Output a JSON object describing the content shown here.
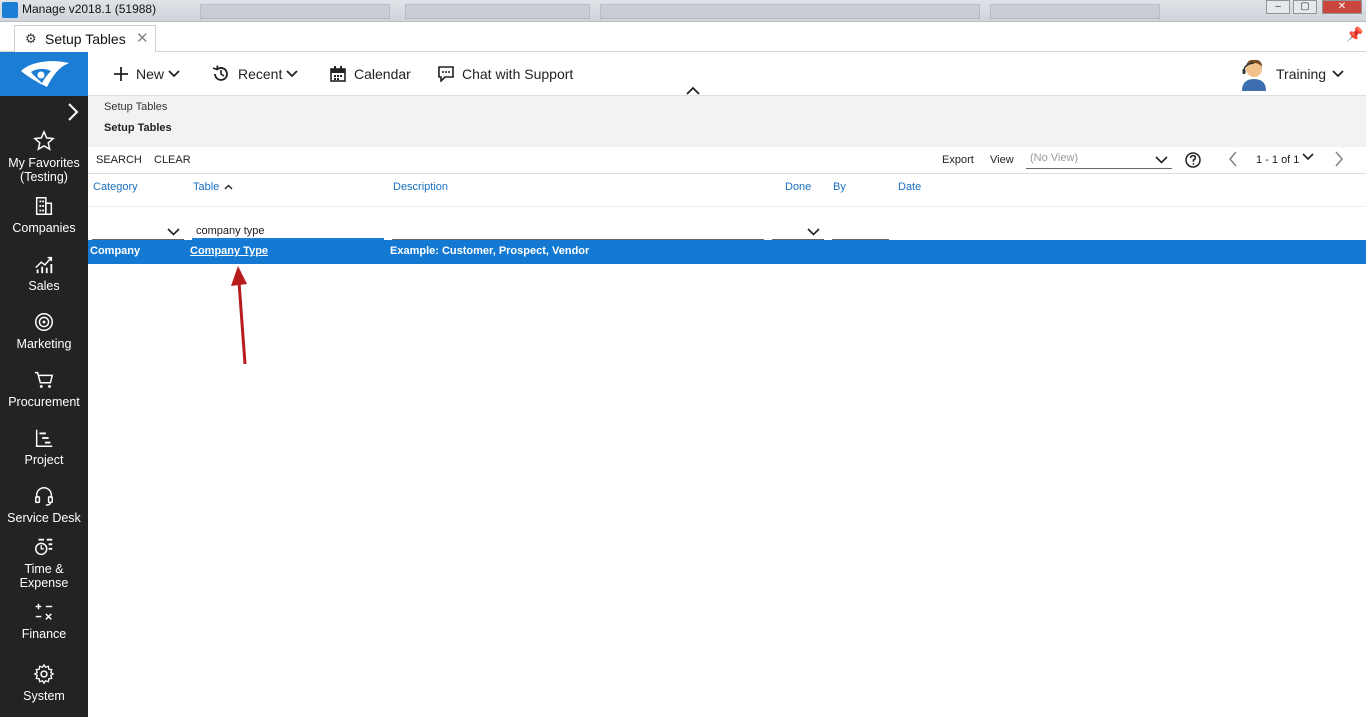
{
  "window": {
    "title": "Manage v2018.1 (51988)"
  },
  "tab": {
    "label": "Setup Tables"
  },
  "toolbar": {
    "new_label": "New",
    "recent_label": "Recent",
    "calendar_label": "Calendar",
    "chat_label": "Chat with Support",
    "user_label": "Training"
  },
  "sidebar": {
    "items": [
      {
        "label": "My Favorites (Testing)",
        "icon": "star-icon"
      },
      {
        "label": "Companies",
        "icon": "building-icon"
      },
      {
        "label": "Sales",
        "icon": "chart-icon"
      },
      {
        "label": "Marketing",
        "icon": "target-icon"
      },
      {
        "label": "Procurement",
        "icon": "cart-icon"
      },
      {
        "label": "Project",
        "icon": "gantt-icon"
      },
      {
        "label": "Service Desk",
        "icon": "headset-icon"
      },
      {
        "label": "Time & Expense",
        "icon": "timer-icon"
      },
      {
        "label": "Finance",
        "icon": "calculator-icon"
      },
      {
        "label": "System",
        "icon": "gear-icon"
      }
    ]
  },
  "breadcrumb": {
    "parent": "Setup Tables",
    "current": "Setup Tables"
  },
  "actions": {
    "search_label": "SEARCH",
    "clear_label": "CLEAR",
    "export_label": "Export",
    "view_label": "View",
    "view_value": "(No View)",
    "pager_text": "1 - 1 of 1"
  },
  "table": {
    "columns": [
      "Category",
      "Table",
      "Description",
      "Done",
      "By",
      "Date"
    ],
    "filter_table_value": "company type",
    "rows": [
      {
        "category": "Company",
        "table": "Company Type",
        "description": "Example: Customer, Prospect, Vendor"
      }
    ]
  },
  "colors": {
    "accent": "#1b7ed4",
    "sidebar": "#222325",
    "row_selected": "#1479d2",
    "arrow": "#b71c1c"
  }
}
